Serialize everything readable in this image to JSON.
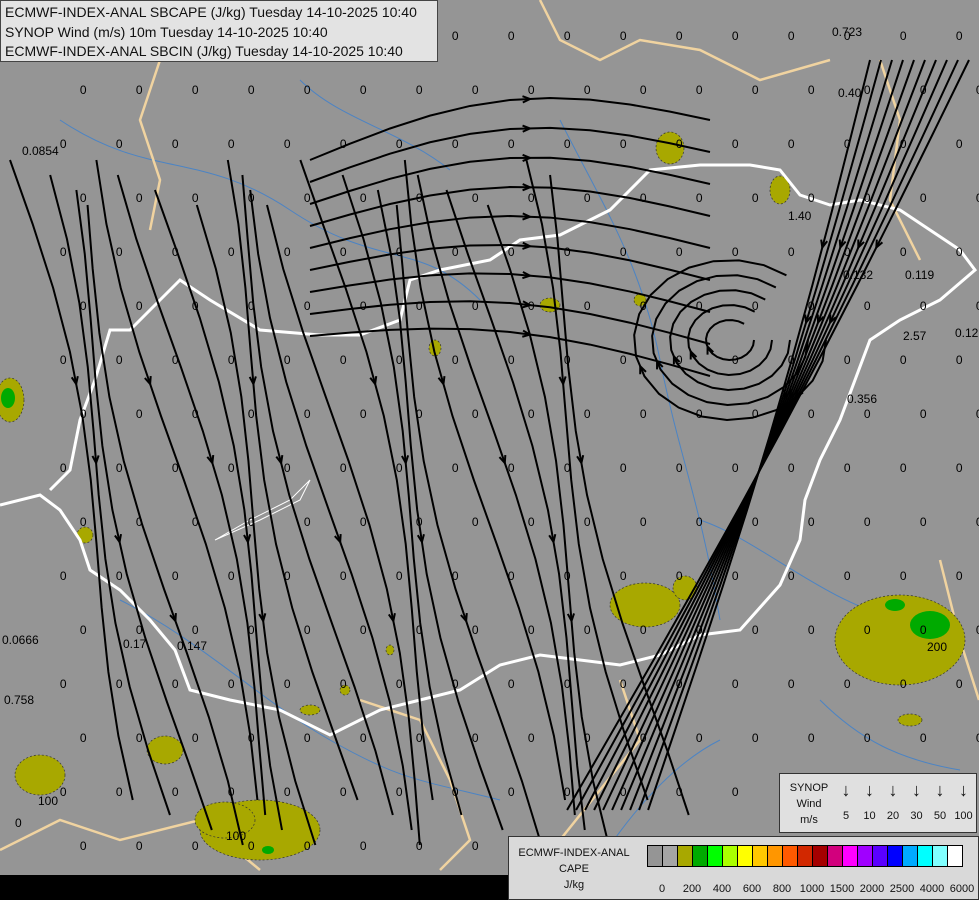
{
  "header": {
    "lines": [
      "ECMWF-INDEX-ANAL SBCAPE (J/kg) Tuesday 14-10-2025 10:40",
      "SYNOP Wind (m/s) 10m Tuesday 14-10-2025 10:40",
      "ECMWF-INDEX-ANAL SBCIN (J/kg) Tuesday 14-10-2025 10:40"
    ]
  },
  "synop_legend": {
    "title": [
      "SYNOP",
      "Wind",
      "m/s"
    ],
    "icon": "wind-arrow-down-icon",
    "speeds": [
      "5",
      "10",
      "20",
      "30",
      "50",
      "100"
    ]
  },
  "cape_legend": {
    "title": [
      "ECMWF-INDEX-ANAL",
      "CAPE",
      "J/kg"
    ],
    "colors": [
      "#959595",
      "#a5a5a5",
      "#a8a800",
      "#00aa00",
      "#00ff00",
      "#aaff00",
      "#ffff00",
      "#ffc800",
      "#ff9600",
      "#ff5a00",
      "#d22800",
      "#a50000",
      "#d2007d",
      "#ff00ff",
      "#a000ff",
      "#5a00ff",
      "#0000ff",
      "#00aaff",
      "#00ffff",
      "#80ffff",
      "#ffffff"
    ],
    "ticks": [
      "0",
      "200",
      "400",
      "600",
      "800",
      "1000",
      "1500",
      "2000",
      "2500",
      "4000",
      "6000"
    ]
  },
  "map": {
    "colors": {
      "background": "#959595",
      "border": "#ffffff",
      "coast_region": "#f0d3a0",
      "rivers": "#3a7fd0",
      "cape_low": "#a8a800",
      "cape_mid": "#00aa00"
    },
    "cin_labels": [
      "0.723",
      "0.0854",
      "1.40",
      "0.40",
      "0.132",
      "0.119",
      "2.57",
      "0.12",
      "0.356",
      "0.0666",
      "0.758",
      "0.17",
      "0.147",
      "100",
      "100",
      "200",
      "0"
    ]
  }
}
